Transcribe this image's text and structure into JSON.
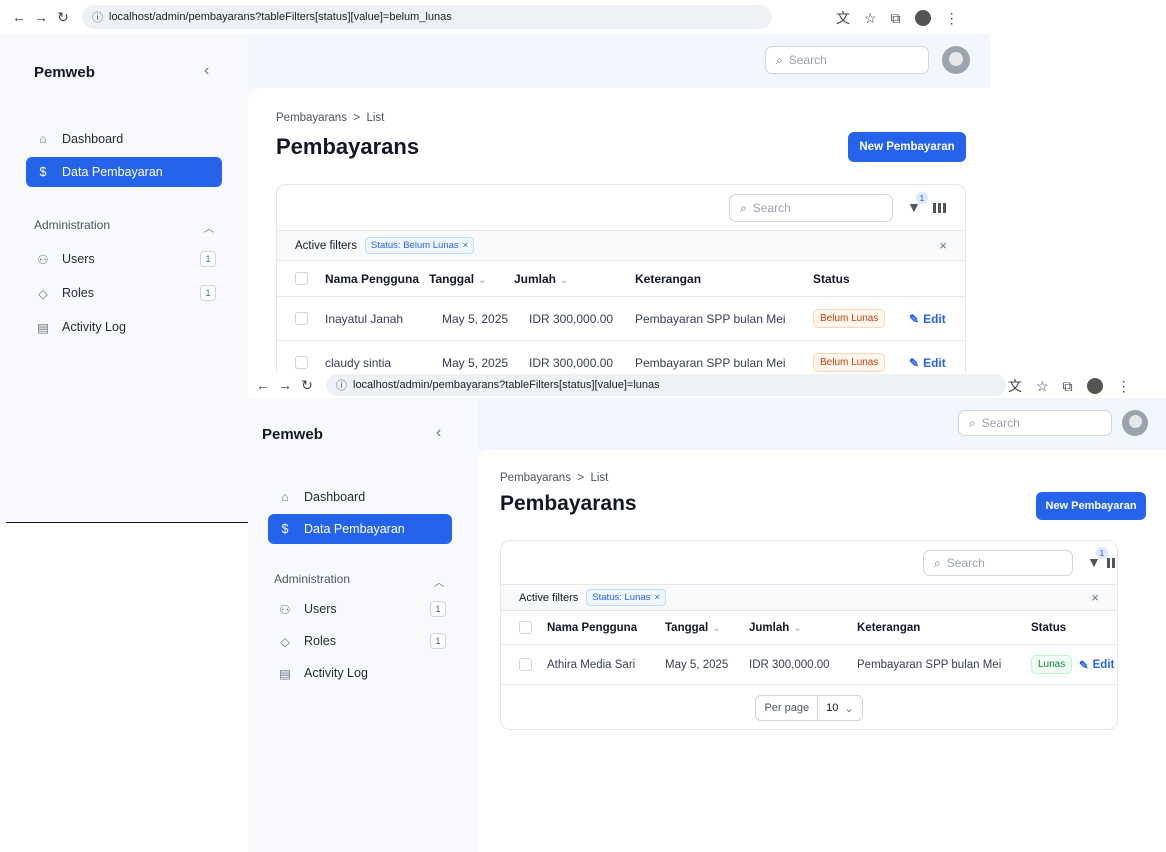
{
  "back": {
    "url": "localhost/admin/pembayarans?tableFilters[status][value]=belum_lunas",
    "brand": "Pemweb",
    "nav": {
      "dashboard": "Dashboard",
      "data_pembayaran": "Data Pembayaran",
      "group": "Administration",
      "users": "Users",
      "users_count": "1",
      "roles": "Roles",
      "roles_count": "1",
      "activity": "Activity Log"
    },
    "search_placeholder": "Search",
    "breadcrumb": {
      "parent": "Pembayarans",
      "sep": ">",
      "current": "List"
    },
    "title": "Pembayarans",
    "new_button": "New Pembayaran",
    "table_search": "Search",
    "filter_count": "1",
    "active_filters_label": "Active filters",
    "filter_chip": "Status: Belum Lunas",
    "columns": [
      "Nama Pengguna",
      "Tanggal",
      "Jumlah",
      "Keterangan",
      "Status"
    ],
    "rows": [
      {
        "nama": "Inayatul Janah",
        "tanggal": "May 5, 2025",
        "jumlah": "IDR 300,000.00",
        "keterangan": "Pembayaran SPP bulan Mei",
        "status": "Belum Lunas",
        "edit": "Edit"
      },
      {
        "nama": "claudy sintia",
        "tanggal": "May 5, 2025",
        "jumlah": "IDR 300,000.00",
        "keterangan": "Pembayaran SPP bulan Mei",
        "status": "Belum Lunas",
        "edit": "Edit"
      }
    ]
  },
  "front": {
    "url": "localhost/admin/pembayarans?tableFilters[status][value]=lunas",
    "brand": "Pemweb",
    "nav": {
      "dashboard": "Dashboard",
      "data_pembayaran": "Data Pembayaran",
      "group": "Administration",
      "users": "Users",
      "users_count": "1",
      "roles": "Roles",
      "roles_count": "1",
      "activity": "Activity Log"
    },
    "search_placeholder": "Search",
    "breadcrumb": {
      "parent": "Pembayarans",
      "sep": ">",
      "current": "List"
    },
    "title": "Pembayarans",
    "new_button": "New Pembayaran",
    "table_search": "Search",
    "filter_count": "1",
    "active_filters_label": "Active filters",
    "filter_chip": "Status: Lunas",
    "columns": [
      "Nama Pengguna",
      "Tanggal",
      "Jumlah",
      "Keterangan",
      "Status"
    ],
    "rows": [
      {
        "nama": "Athira Media Sari",
        "tanggal": "May 5, 2025",
        "jumlah": "IDR 300,000.00",
        "keterangan": "Pembayaran SPP bulan Mei",
        "status": "Lunas",
        "edit": "Edit"
      }
    ],
    "per_page_label": "Per page",
    "per_page_value": "10"
  },
  "icons": {
    "back": "arrow-left-icon",
    "forward": "arrow-right-icon",
    "reload": "reload-icon",
    "info": "info-icon",
    "translate": "translate-icon",
    "star": "star-icon",
    "extensions": "puzzle-icon",
    "menu": "more-vert-icon"
  },
  "colors": {
    "primary": "#2563eb",
    "warning": "#c2410c",
    "success": "#15803d"
  }
}
